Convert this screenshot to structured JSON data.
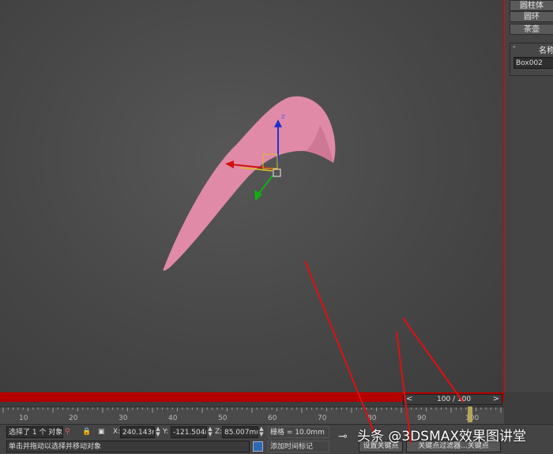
{
  "command_panel": {
    "buttons": [
      "圆柱体",
      "圆环",
      "茶壶"
    ],
    "rollout_toggle": "-",
    "rollout_title": "名称",
    "object_name": "Box002"
  },
  "gizmo": {
    "z_label": "z"
  },
  "time_slider": {
    "prev": "<",
    "next": ">",
    "value": "100 / 100"
  },
  "ruler": {
    "ticks": [
      "10",
      "20",
      "30",
      "40",
      "50",
      "60",
      "70",
      "80",
      "90",
      "100"
    ]
  },
  "status": {
    "selection": "选择了 1 个 对象",
    "prompt": "单击并拖动以选择并移动对象",
    "x_label": "X:",
    "x_value": "240.143m",
    "y_label": "Y:",
    "y_value": "-121.504m",
    "z_label": "Z:",
    "z_value": "85.007mm",
    "grid": "栅格 = 10.0mm",
    "add_time_tag": "添加时间标记",
    "set_key": "设置关键点",
    "key_filter": "关键点过滤器...关键点"
  },
  "watermark": "头条 @3DSMAX效果图讲堂",
  "colors": {
    "accent": "#b50000",
    "shape": "#e08aa8",
    "x_axis": "#d01010",
    "y_axis": "#10b010",
    "z_axis": "#2030d0"
  }
}
